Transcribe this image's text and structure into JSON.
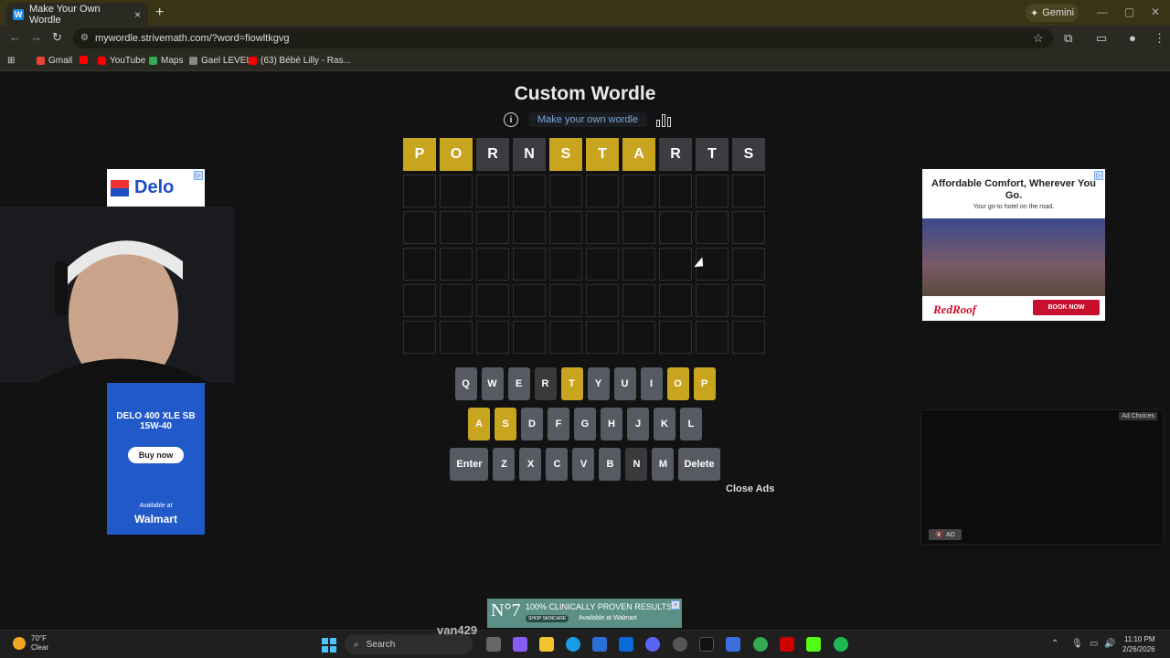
{
  "browser": {
    "tab_title": "Make Your Own Wordle",
    "tab_favicon": "W",
    "gemini_label": "Gemini",
    "url": "mywordle.strivemath.com/?word=fiowltkgvg",
    "bookmarks": [
      "Gmail",
      "YouTube",
      "Maps",
      "Gael LEVEL",
      "(63) Bébé Lilly - Ras..."
    ]
  },
  "game": {
    "title": "Custom Wordle",
    "make_link": "Make your own wordle",
    "guess_rows": [
      [
        {
          "letter": "P",
          "state": "present"
        },
        {
          "letter": "O",
          "state": "present"
        },
        {
          "letter": "R",
          "state": "absent"
        },
        {
          "letter": "N",
          "state": "absent"
        },
        {
          "letter": "S",
          "state": "present"
        },
        {
          "letter": "T",
          "state": "present"
        },
        {
          "letter": "A",
          "state": "present"
        },
        {
          "letter": "R",
          "state": "absent"
        },
        {
          "letter": "T",
          "state": "absent"
        },
        {
          "letter": "S",
          "state": "absent"
        }
      ]
    ],
    "total_rows": 6,
    "word_length": 10,
    "keyboard": [
      [
        {
          "k": "Q",
          "s": "unused"
        },
        {
          "k": "W",
          "s": "unused"
        },
        {
          "k": "E",
          "s": "unused"
        },
        {
          "k": "R",
          "s": "absent"
        },
        {
          "k": "T",
          "s": "present"
        },
        {
          "k": "Y",
          "s": "unused"
        },
        {
          "k": "U",
          "s": "unused"
        },
        {
          "k": "I",
          "s": "unused"
        },
        {
          "k": "O",
          "s": "present"
        },
        {
          "k": "P",
          "s": "present"
        }
      ],
      [
        {
          "k": "A",
          "s": "present"
        },
        {
          "k": "S",
          "s": "present"
        },
        {
          "k": "D",
          "s": "unused"
        },
        {
          "k": "F",
          "s": "unused"
        },
        {
          "k": "G",
          "s": "unused"
        },
        {
          "k": "H",
          "s": "unused"
        },
        {
          "k": "J",
          "s": "unused"
        },
        {
          "k": "K",
          "s": "unused"
        },
        {
          "k": "L",
          "s": "unused"
        }
      ],
      [
        {
          "k": "Enter",
          "s": "unused",
          "wide": true
        },
        {
          "k": "Z",
          "s": "unused"
        },
        {
          "k": "X",
          "s": "unused"
        },
        {
          "k": "C",
          "s": "unused"
        },
        {
          "k": "V",
          "s": "unused"
        },
        {
          "k": "B",
          "s": "unused"
        },
        {
          "k": "N",
          "s": "absent"
        },
        {
          "k": "M",
          "s": "unused"
        },
        {
          "k": "Delete",
          "s": "unused",
          "wide": true
        }
      ]
    ],
    "close_ads": "Close Ads"
  },
  "ads": {
    "left": {
      "brand": "Delo",
      "product": "DELO 400 XLE SB 15W-40",
      "button": "Buy now",
      "avail": "Available at",
      "store": "Walmart"
    },
    "right": {
      "headline": "Affordable Comfort, Wherever You Go.",
      "sub": "Your go-to hotel on the road.",
      "brand": "RedRoof",
      "button": "BOOK NOW"
    },
    "video": {
      "choices": "Ad Choices",
      "mute": "AD"
    },
    "bottom": {
      "logo": "N°7",
      "text": "100% CLINICALLY PROVEN RESULTS",
      "shop": "SHOP SKINCARE",
      "avail": "Available at Walmart"
    }
  },
  "taskbar": {
    "temp": "70°F",
    "condition": "Clear",
    "search": "Search",
    "overlay_name": "van429",
    "time": "11:10 PM",
    "date": "2/26/2026"
  },
  "colors": {
    "present": "#c9a41f",
    "absent": "#3a3a3c",
    "unused": "#575a62"
  }
}
